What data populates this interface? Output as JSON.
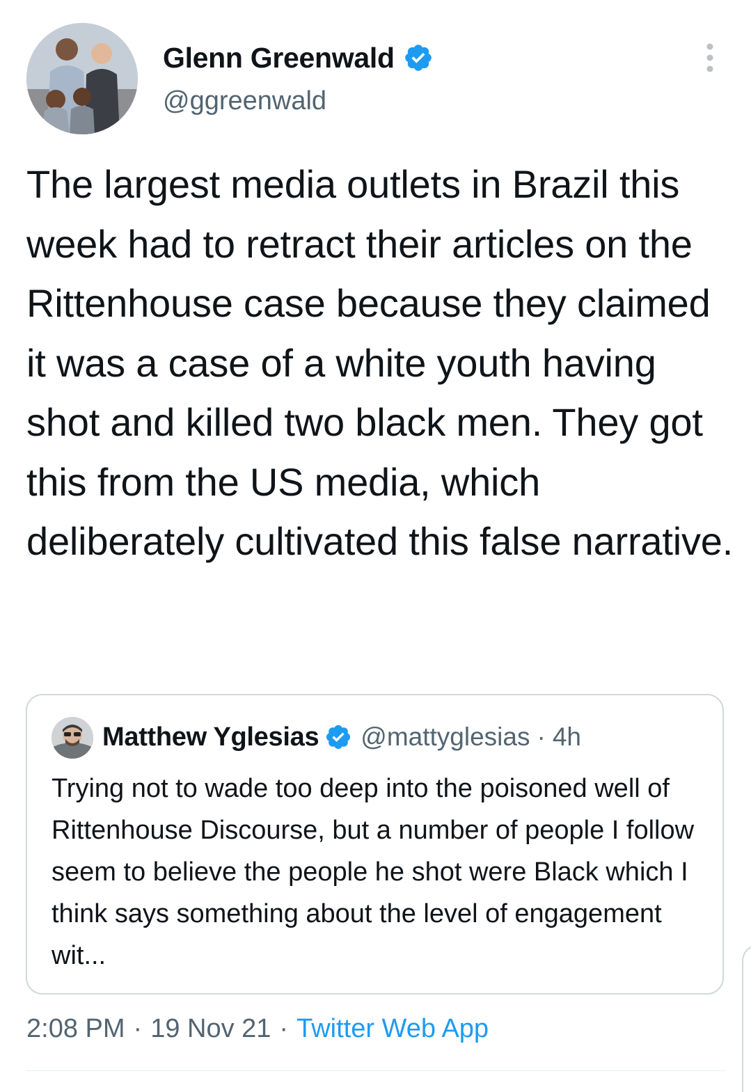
{
  "tweet": {
    "author": {
      "name": "Glenn Greenwald",
      "handle": "@ggreenwald",
      "verified": true
    },
    "text": "The largest media outlets in Brazil this week had to retract their articles on the Rittenhouse case because they claimed it was a case of a white youth having shot and killed two black men. They got this from the US media, which deliberately cultivated this false narrative.",
    "quoted_tweet": {
      "author": {
        "name": "Matthew Yglesias",
        "handle": "@mattyglesias",
        "verified": true
      },
      "separator": "·",
      "time": "4h",
      "text": "Trying not to wade too deep into the poisoned well of Rittenhouse Discourse, but a number of people I follow seem to believe the people he shot were Black which I think says something about the level of engagement wit..."
    },
    "meta": {
      "time": "2:08 PM",
      "separator": "·",
      "date": "19 Nov 21",
      "source": "Twitter Web App"
    }
  },
  "icons": {
    "more": "more-vertical-icon",
    "verified": "verified-badge-icon"
  },
  "colors": {
    "text": "#0f1419",
    "secondary": "#536471",
    "accent": "#1d9bf0",
    "border": "#cfd9de"
  }
}
